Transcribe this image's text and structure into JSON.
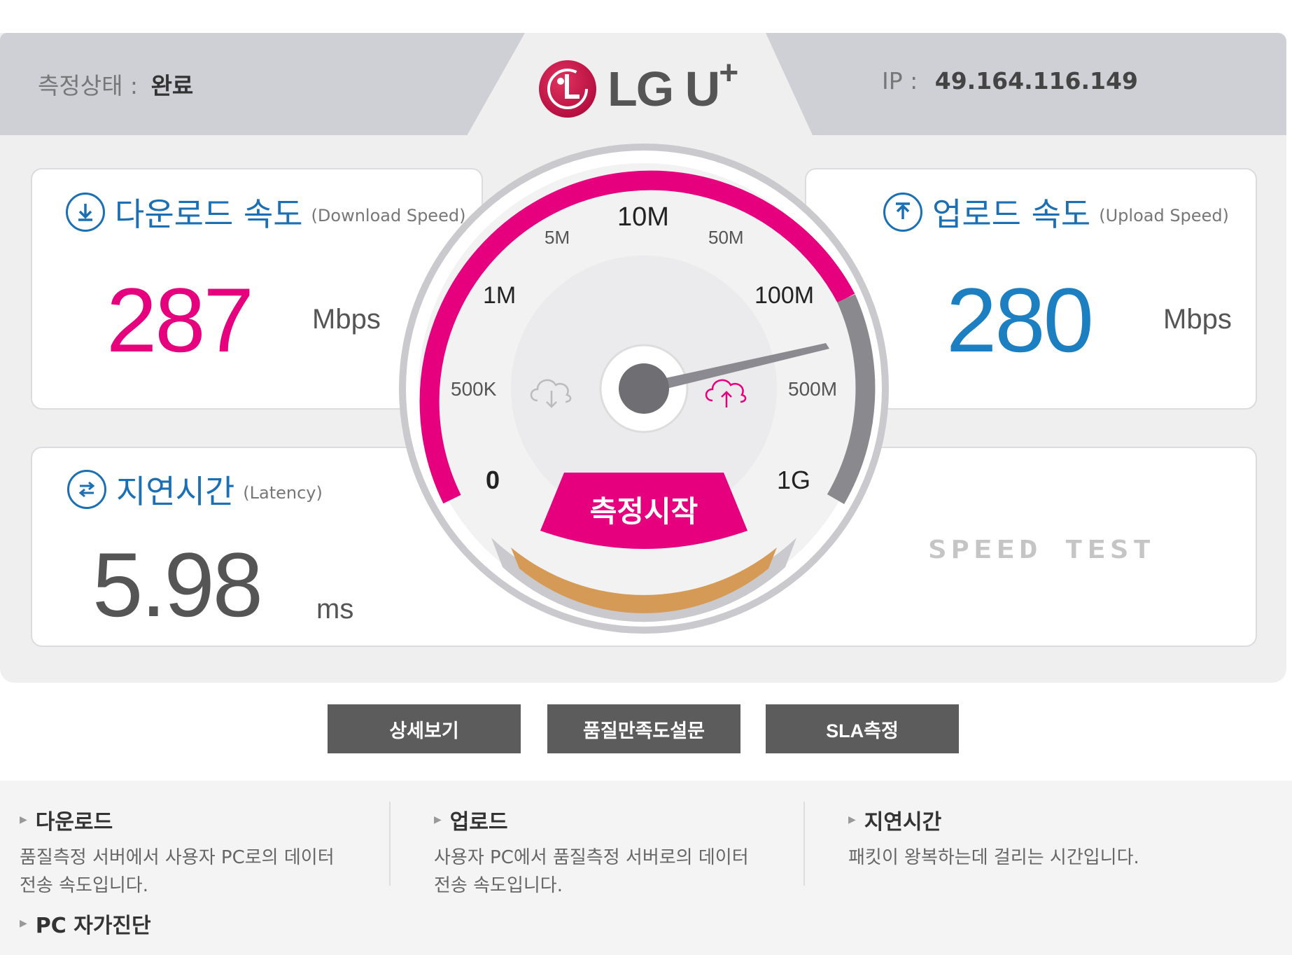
{
  "header": {
    "status_label": "측정상태 :",
    "status_value": "완료",
    "ip_label": "IP :",
    "ip_value": "49.164.116.149",
    "logo_text": "LG U",
    "logo_plus": "+"
  },
  "download": {
    "title": "다운로드 속도",
    "subtitle": "(Download Speed)",
    "value": "287",
    "unit": "Mbps",
    "color": "#e6007e"
  },
  "upload": {
    "title": "업로드 속도",
    "subtitle": "(Upload Speed)",
    "value": "280",
    "unit": "Mbps",
    "color": "#1b7fc1"
  },
  "latency": {
    "title": "지연시간",
    "subtitle": "(Latency)",
    "value": "5.98",
    "unit": "ms"
  },
  "speed_test_logo": "SPEED TEST",
  "gauge": {
    "labels": [
      "0",
      "500K",
      "1M",
      "5M",
      "10M",
      "50M",
      "100M",
      "500M",
      "1G"
    ],
    "start_button": "측정시작",
    "accent": "#e6007e"
  },
  "buttons": {
    "detail": "상세보기",
    "survey": "품질만족도설문",
    "sla": "SLA측정"
  },
  "info": {
    "download_title": "다운로드",
    "download_line1": "품질측정 서버에서 사용자 PC로의 데이터",
    "download_line2": "전송 속도입니다.",
    "upload_title": "업로드",
    "upload_line1": "사용자 PC에서 품질측정 서버로의 데이터",
    "upload_line2": "전송 속도입니다.",
    "latency_title": "지연시간",
    "latency_line1": "패킷이 왕복하는데 걸리는 시간입니다.",
    "pc_title": "PC 자가진단"
  }
}
